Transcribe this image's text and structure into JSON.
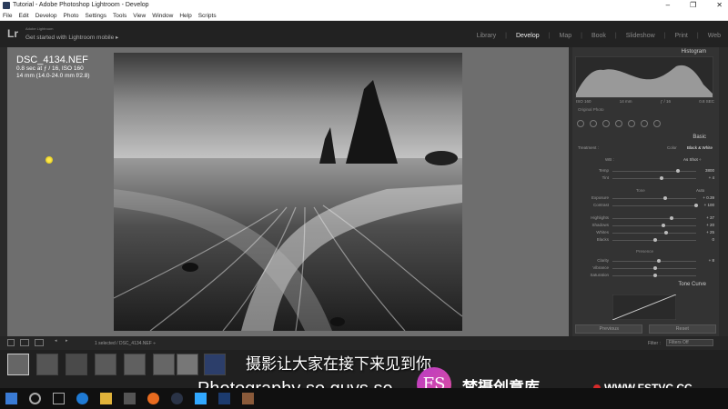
{
  "window": {
    "title": "Tutorial - Adobe Photoshop Lightroom - Develop",
    "controls": [
      "–",
      "❐",
      "✕"
    ]
  },
  "menu": [
    "File",
    "Edit",
    "Develop",
    "Photo",
    "Settings",
    "Tools",
    "View",
    "Window",
    "Help",
    "Scripts"
  ],
  "identity": {
    "logo": "Lr",
    "brand": "Adobe Lightroom",
    "mobile_prompt": "Get started with Lightroom mobile ▸"
  },
  "modules": [
    "Library",
    "Develop",
    "Map",
    "Book",
    "Slideshow",
    "Print",
    "Web"
  ],
  "active_module": "Develop",
  "photo_info": {
    "filename": "DSC_4134.NEF",
    "exposure": "0.8 sec at ƒ / 16, ISO 160",
    "lens": "14 mm (14.0-24.0 mm f/2.8)"
  },
  "panel": {
    "histogram_label": "Histogram",
    "histo_foot": [
      "ISO 160",
      "14 mm",
      "ƒ / 16",
      "0.8 SEC"
    ],
    "original_photo": "Original Photo",
    "basic_label": "Basic",
    "treatment_label": "Treatment :",
    "treatment_color": "Color",
    "treatment_bw": "Black & White",
    "wb_label": "WB :",
    "wb_value": "As Shot ÷",
    "tone_label": "Tone",
    "tone_auto": "Auto",
    "presence_label": "Presence",
    "rows": [
      {
        "label": "Temp",
        "value": "3800",
        "knob": 0.78
      },
      {
        "label": "Tint",
        "value": "+ 4",
        "knob": 0.58
      },
      {
        "label": "Exposure",
        "value": "+ 0.39",
        "knob": 0.62
      },
      {
        "label": "Contrast",
        "value": "+ 100",
        "knob": 1.0
      },
      {
        "label": "Highlights",
        "value": "+ 37",
        "knob": 0.7
      },
      {
        "label": "Shadows",
        "value": "+ 20",
        "knob": 0.6
      },
      {
        "label": "Whites",
        "value": "+ 25",
        "knob": 0.63
      },
      {
        "label": "Blacks",
        "value": "0",
        "knob": 0.5
      },
      {
        "label": "Clarity",
        "value": "+ 8",
        "knob": 0.54
      },
      {
        "label": "Vibrance",
        "value": "",
        "knob": 0.5
      },
      {
        "label": "Saturation",
        "value": "",
        "knob": 0.5
      }
    ],
    "tone_curve_label": "Tone Curve",
    "previous_button": "Previous",
    "reset_button": "Reset"
  },
  "filmbar": {
    "path_text": "1 selected / DSC_4134.NEF ÷",
    "filter_label": "Filter :",
    "filter_value": "Filters Off"
  },
  "subtitles": {
    "chinese": "摄影让大家在接下来见到你",
    "english": "Photography so guys se"
  },
  "watermark": {
    "logo": "FS",
    "name": "梵摄创意库",
    "url": "WWW.FSTVC.CC"
  }
}
